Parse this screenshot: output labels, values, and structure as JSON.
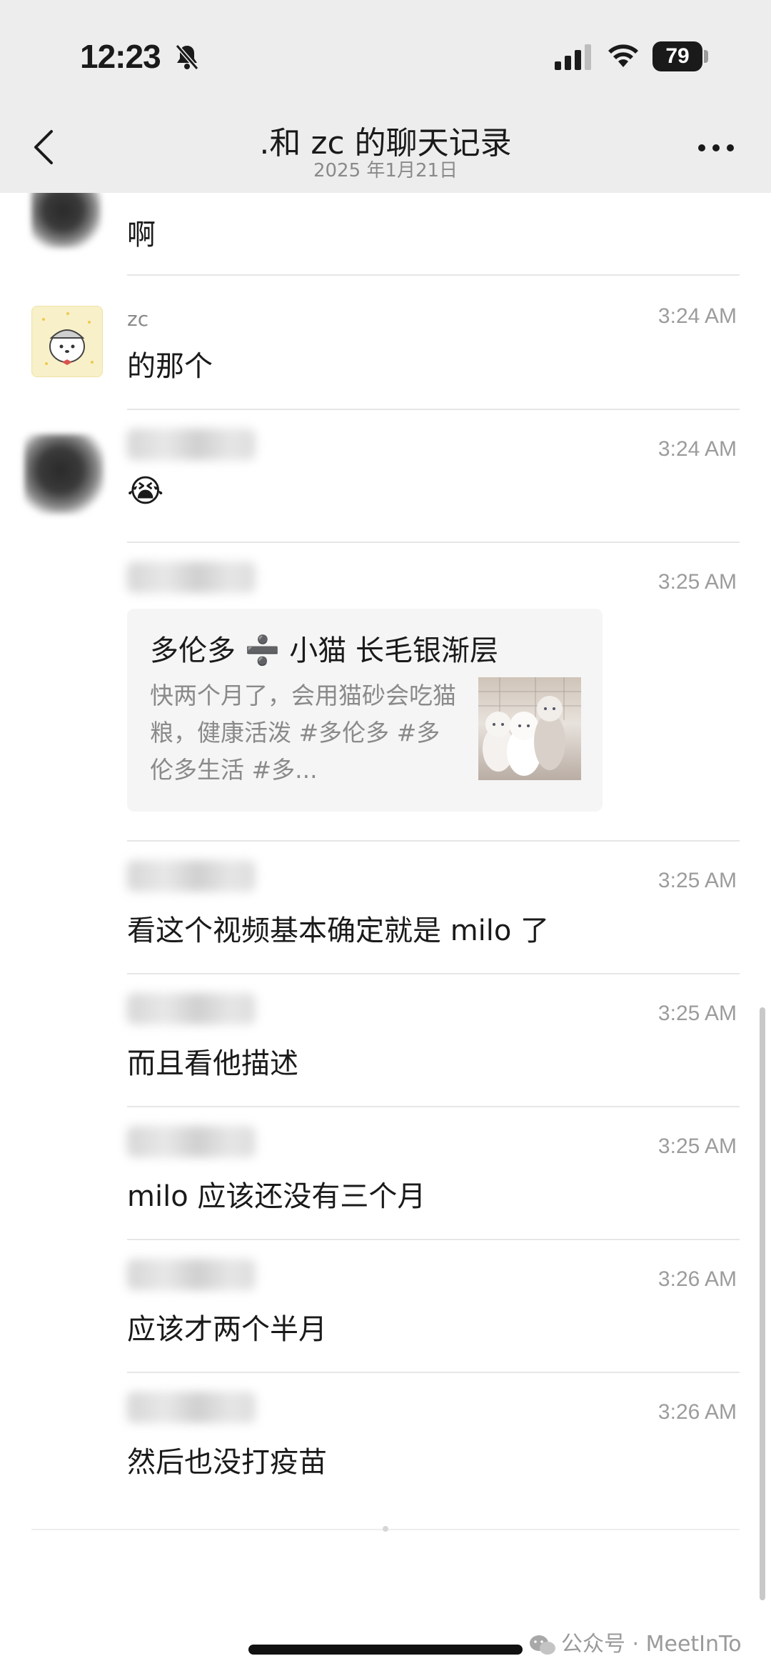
{
  "status_bar": {
    "time": "12:23",
    "battery": "79",
    "icons": [
      "bell-slash-icon",
      "signal-icon",
      "wifi-icon",
      "battery-icon"
    ]
  },
  "header": {
    "title": ".和 zc 的聊天记录",
    "subtitle": "2025 年1月21日",
    "back_icon": "chevron-left-icon",
    "more_icon": "more-icon"
  },
  "messages": [
    {
      "sender": "",
      "time": "",
      "text": "啊"
    },
    {
      "sender": "zc",
      "time": "3:24 AM",
      "text": "的那个"
    },
    {
      "sender": "",
      "time": "3:24 AM",
      "text": "😭"
    },
    {
      "sender": "",
      "time": "3:25 AM",
      "card": {
        "title": "多伦多 ➗ 小猫 长毛银渐层",
        "desc": "快两个月了，会用猫砂会吃猫粮，健康活泼 #多伦多 #多伦多生活 #多..."
      }
    },
    {
      "sender": "",
      "time": "3:25 AM",
      "text": "看这个视频基本确定就是 milo 了"
    },
    {
      "sender": "",
      "time": "3:25 AM",
      "text": "而且看他描述"
    },
    {
      "sender": "",
      "time": "3:25 AM",
      "text": "milo 应该还没有三个月"
    },
    {
      "sender": "",
      "time": "3:26 AM",
      "text": "应该才两个半月"
    },
    {
      "sender": "",
      "time": "3:26 AM",
      "text": "然后也没打疫苗"
    }
  ],
  "watermark": "公众号 · MeetInTo",
  "colors": {
    "header_bg": "#ededed",
    "time_gray": "#9c9c9c",
    "card_bg": "#f5f5f5"
  }
}
